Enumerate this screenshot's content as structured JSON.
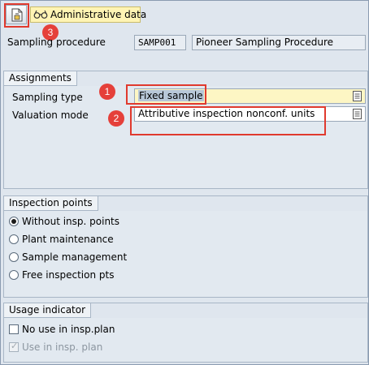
{
  "toolbar": {
    "admin_label": "Administrative data",
    "save_icon": "document-save-icon",
    "admin_icon": "glasses-icon"
  },
  "header": {
    "sampling_procedure_label": "Sampling procedure",
    "sampling_procedure_code": "SAMP001",
    "sampling_procedure_desc": "Pioneer Sampling Procedure"
  },
  "assignments": {
    "title": "Assignments",
    "sampling_type_label": "Sampling type",
    "sampling_type_value": "Fixed sample",
    "valuation_mode_label": "Valuation mode",
    "valuation_mode_value": "Attributive inspection nonconf. units"
  },
  "inspection_points": {
    "title": "Inspection points",
    "options": [
      {
        "label": "Without insp. points",
        "selected": true
      },
      {
        "label": "Plant maintenance",
        "selected": false
      },
      {
        "label": "Sample management",
        "selected": false
      },
      {
        "label": "Free inspection pts",
        "selected": false
      }
    ]
  },
  "usage_indicator": {
    "title": "Usage indicator",
    "no_use_label": "No use in insp.plan",
    "use_label": "Use in insp. plan"
  },
  "annotations": {
    "badge_1": "1",
    "badge_2": "2",
    "badge_3": "3",
    "highlight_color": "#e03a2e"
  }
}
